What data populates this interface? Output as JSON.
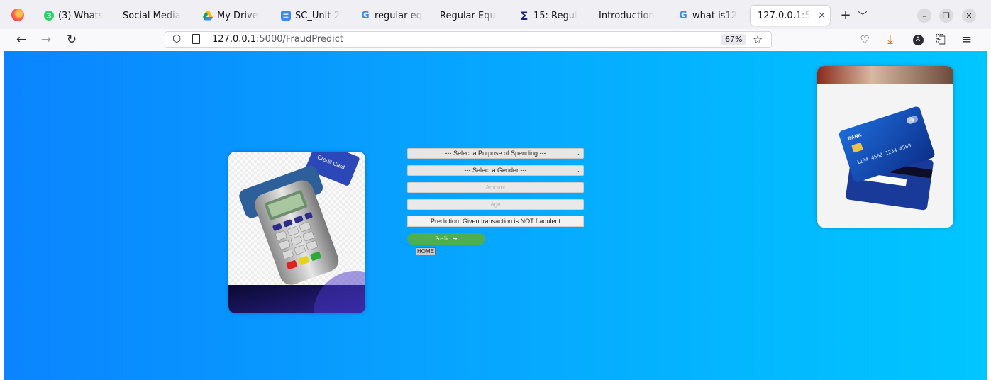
{
  "browser": {
    "tabs": [
      {
        "label": "(3) Whats",
        "icon": "whatsapp-icon",
        "color": "#25d366"
      },
      {
        "label": "Social Media",
        "icon": "none"
      },
      {
        "label": "My Drive",
        "icon": "google-drive-icon"
      },
      {
        "label": "SC_Unit-2",
        "icon": "google-docs-icon",
        "color": "#4285f4"
      },
      {
        "label": "regular eq",
        "icon": "google-icon"
      },
      {
        "label": "Regular Equi",
        "icon": "none"
      },
      {
        "label": "15: Regul",
        "icon": "sigma-icon"
      },
      {
        "label": "Introduction",
        "icon": "none"
      },
      {
        "label": "what is12",
        "icon": "google-icon"
      },
      {
        "label": "127.0.0.1:5",
        "icon": "none",
        "active": true
      }
    ],
    "url_host": "127.0.0.1",
    "url_path": ":5000/FraudPredict",
    "zoom": "67%"
  },
  "form": {
    "purpose_select": "--- Select a Purpose of Spending ---",
    "gender_select": "--- Select a Gender ---",
    "amount_placeholder": "Amount",
    "age_placeholder": "Age",
    "prediction_text": "Prediction: Given transaction is NOT fradulent",
    "predict_button": "Predict ➞",
    "home_link": "HOME"
  },
  "colors": {
    "gradient_start": "#0a84ff",
    "gradient_end": "#00c6ff",
    "predict_button": "#4caf50"
  }
}
